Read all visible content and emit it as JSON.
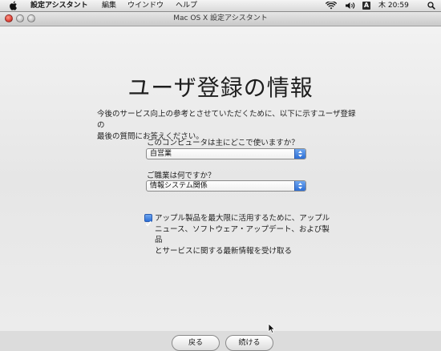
{
  "menubar": {
    "app_name": "設定アシスタント",
    "menus": [
      "編集",
      "ウインドウ",
      "ヘルプ"
    ],
    "input_method": "A",
    "clock": "木 20:59",
    "icons": [
      "apple-icon",
      "wifi-icon",
      "volume-icon",
      "input-menu-icon",
      "spotlight-icon"
    ]
  },
  "window": {
    "title": "Mac OS X 設定アシスタント"
  },
  "page": {
    "heading": "ユーザ登録の情報",
    "intro_line1": "今後のサービス向上の参考とさせていただくために、以下に示すユーザ登録の",
    "intro_line2": "最後の質問にお答えください。",
    "question1": {
      "label": "このコンピュータは主にどこで使いますか？",
      "selected": "自営業"
    },
    "question2": {
      "label": "ご職業は何ですか？",
      "selected": "情報システム関係"
    },
    "checkbox": {
      "checked": true,
      "line1": "アップル製品を最大限に活用するために、アップル",
      "line2": "ニュース、ソフトウェア・アップデート、および製品",
      "line3": "とサービスに関する最新情報を受け取る"
    },
    "buttons": {
      "back": "戻る",
      "continue": "続ける"
    }
  },
  "colors": {
    "accent": "#2d6fd6",
    "close": "#e0443a"
  }
}
